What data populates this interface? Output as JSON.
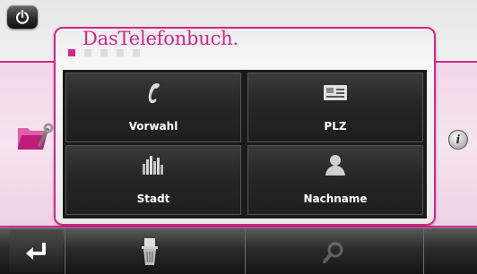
{
  "header": {
    "title": "DasTelefonbuch."
  },
  "pagination": {
    "count": 5,
    "active": 0
  },
  "tiles": [
    {
      "label": "Vorwahl",
      "icon": "phone-icon"
    },
    {
      "label": "PLZ",
      "icon": "postcode-card-icon"
    },
    {
      "label": "Stadt",
      "icon": "city-skyline-icon"
    },
    {
      "label": "Nachname",
      "icon": "person-icon"
    }
  ],
  "side": {
    "left_icon": "folder-settings-icon",
    "right_icon": "info-icon",
    "info_glyph": "i"
  },
  "toolbar": {
    "items": [
      "back-arrow-icon",
      "trash-icon",
      "search-icon"
    ]
  },
  "colors": {
    "accent": "#d5268b",
    "tile_bg": "#262626",
    "toolbar_bg": "#2b2b2b"
  }
}
